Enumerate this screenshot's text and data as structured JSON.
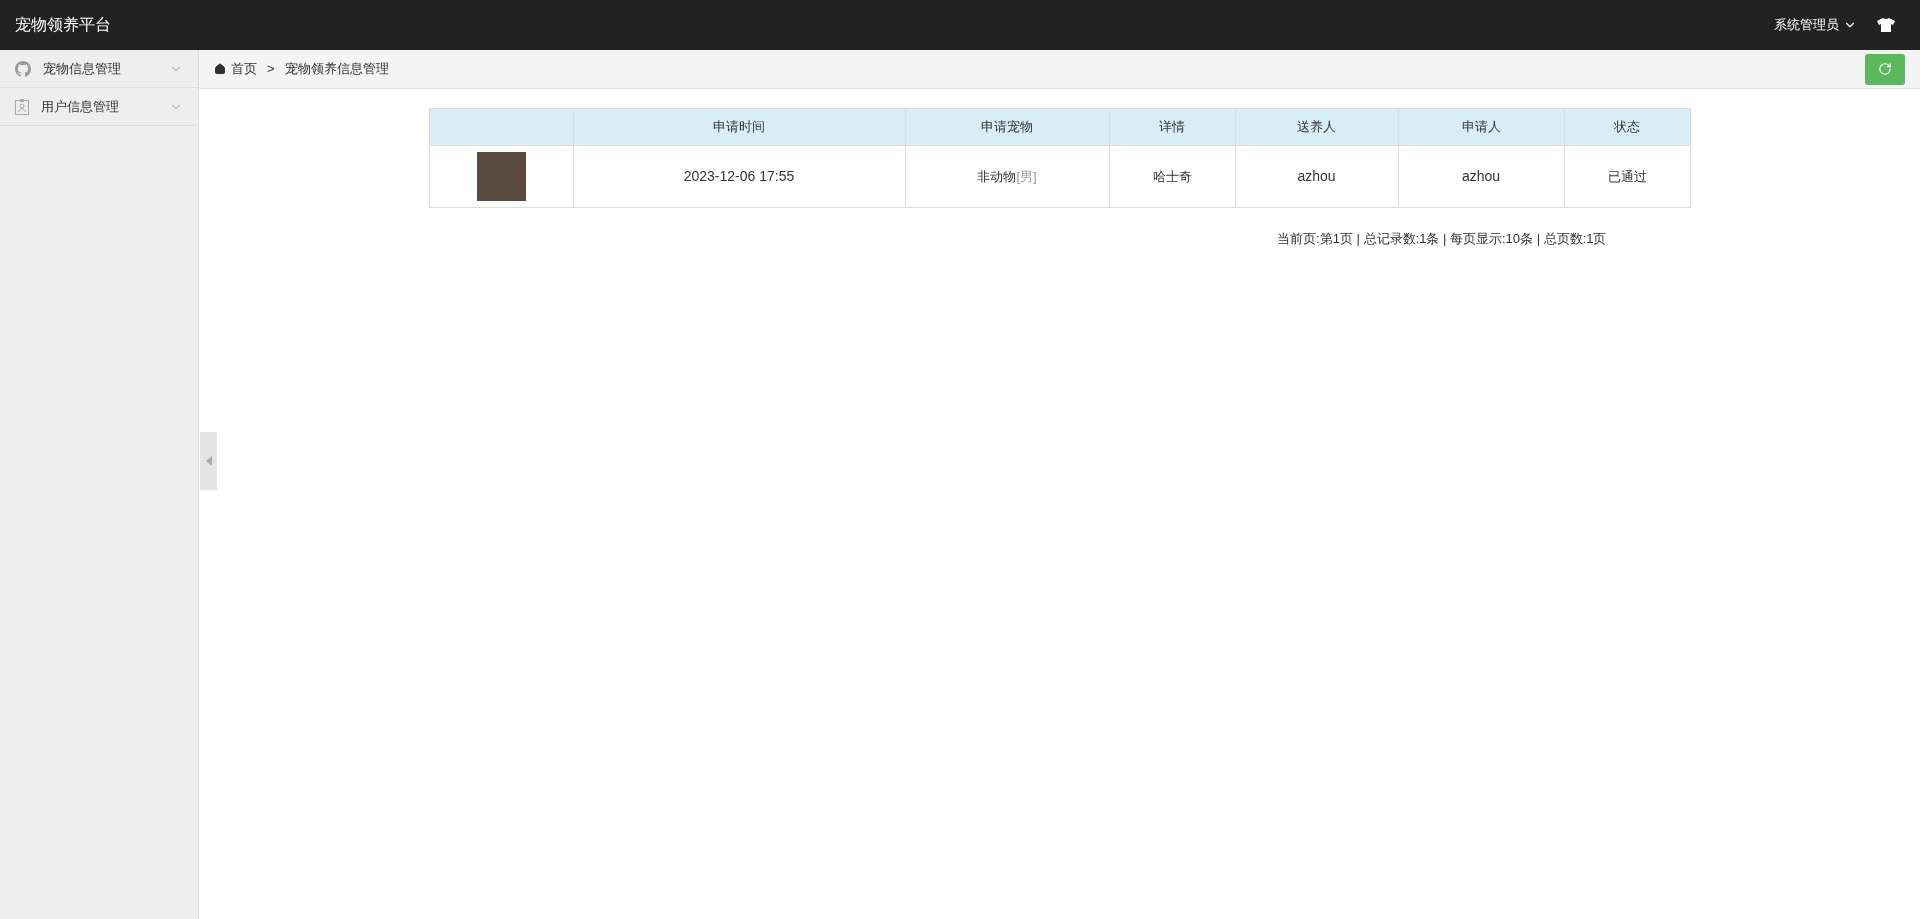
{
  "header": {
    "title": "宠物领养平台",
    "user": "系统管理员"
  },
  "sidebar": {
    "items": [
      {
        "label": "宠物信息管理",
        "kind": "github",
        "expanded": false
      },
      {
        "label": "用户信息管理",
        "kind": "badge",
        "expanded": false
      }
    ]
  },
  "breadcrumb": {
    "home": "首页",
    "separator": ">",
    "current": "宠物领养信息管理"
  },
  "table": {
    "columns": [
      "申请时间",
      "申请宠物",
      "详情",
      "送养人",
      "申请人",
      "状态"
    ],
    "rows": [
      {
        "time": "2023-12-06 17:55",
        "pet": "非动物",
        "pet_tag": "[男]",
        "detail": "哈士奇",
        "giver": "azhou",
        "applicant": "azhou",
        "status": "已通过"
      }
    ]
  },
  "pagination": "当前页:第1页 | 总记录数:1条 | 每页显示:10条 | 总页数:1页"
}
